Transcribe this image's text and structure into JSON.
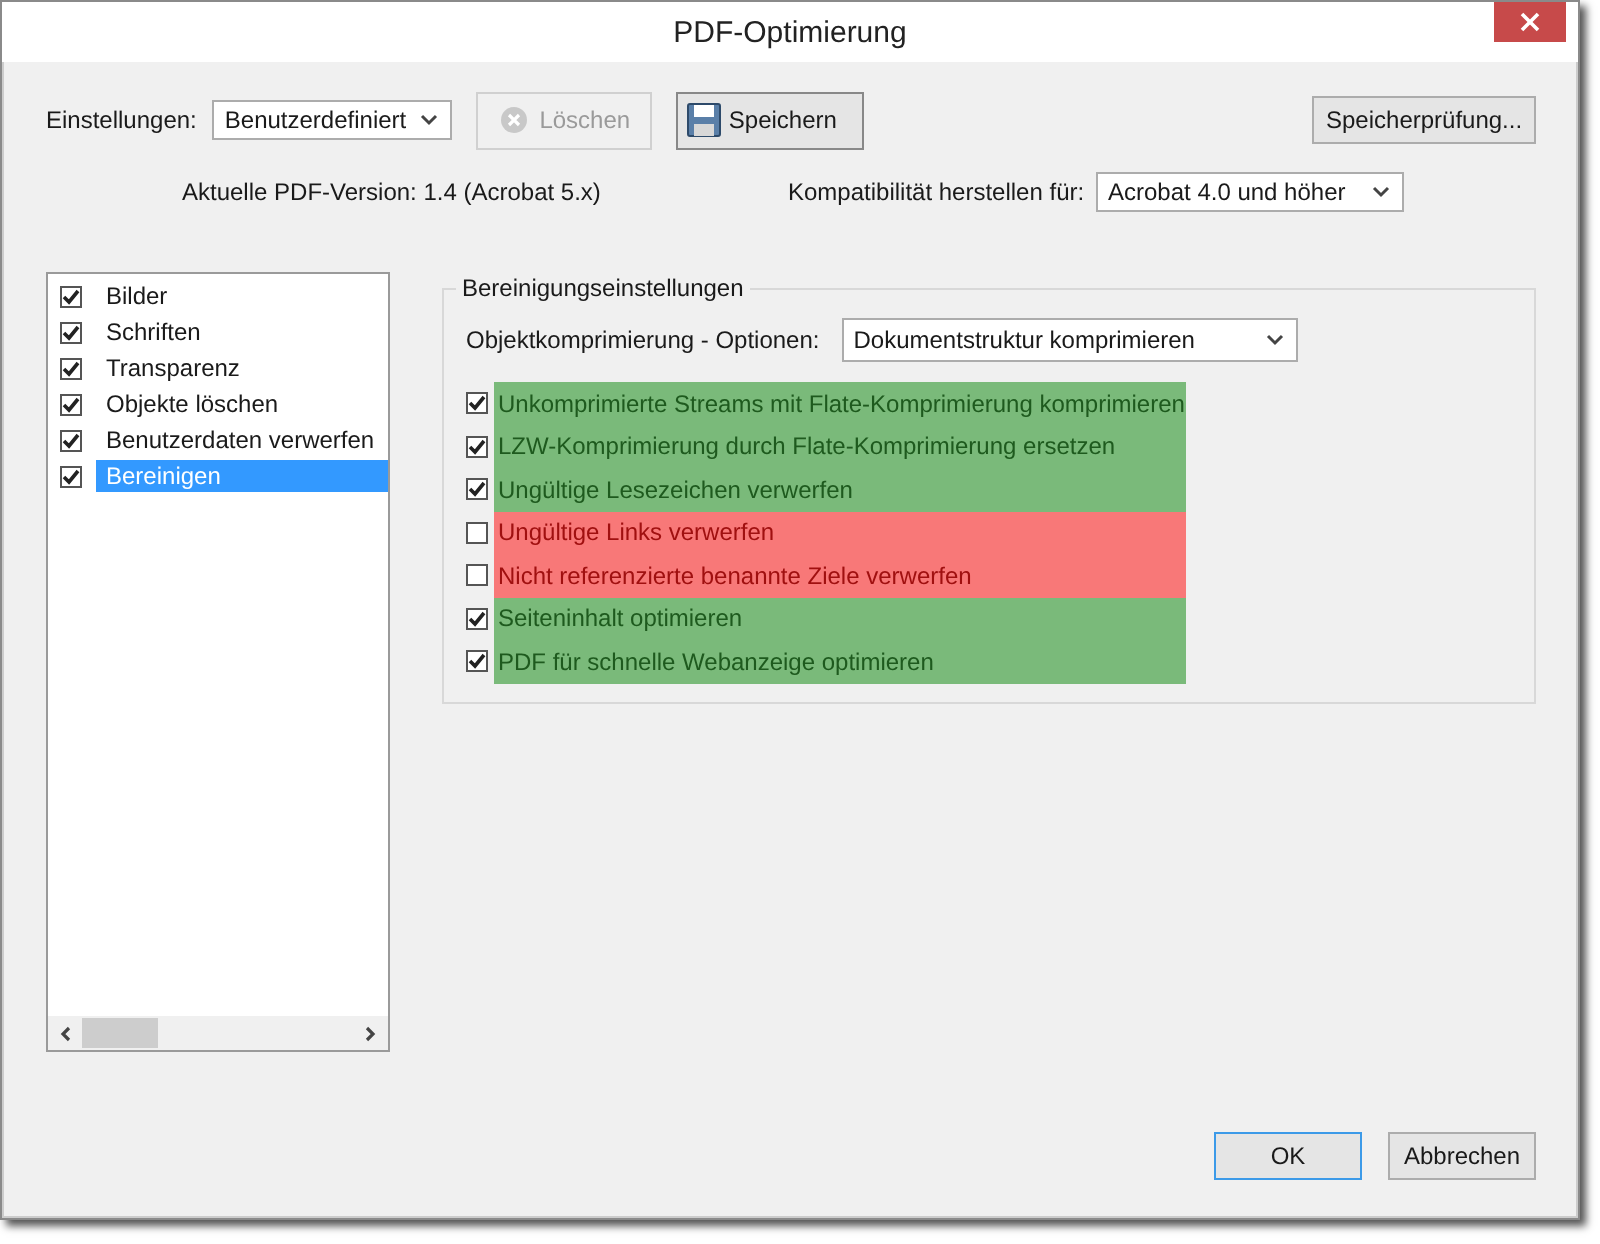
{
  "window": {
    "title": "PDF-Optimierung"
  },
  "settings": {
    "label": "Einstellungen:",
    "value": "Benutzerdefiniert"
  },
  "toolbar": [
    {
      "kind": "delete",
      "label": "Löschen",
      "disabled": true
    },
    {
      "kind": "save",
      "label": "Speichern",
      "disabled": false
    }
  ],
  "audit_button": "Speicherprüfung...",
  "version_text": "Aktuelle PDF-Version: 1.4 (Acrobat 5.x)",
  "compatibility": {
    "label": "Kompatibilität herstellen für:",
    "value": "Acrobat 4.0 und höher"
  },
  "sidebar": {
    "items": [
      {
        "label": "Bilder",
        "checked": true,
        "selected": false
      },
      {
        "label": "Schriften",
        "checked": true,
        "selected": false
      },
      {
        "label": "Transparenz",
        "checked": true,
        "selected": false
      },
      {
        "label": "Objekte löschen",
        "checked": true,
        "selected": false
      },
      {
        "label": "Benutzerdaten verwerfen",
        "checked": true,
        "selected": false
      },
      {
        "label": "Bereinigen",
        "checked": true,
        "selected": true
      }
    ]
  },
  "panel": {
    "title": "Bereinigungseinstellungen",
    "compression": {
      "label": "Objektkomprimierung - Optionen:",
      "value": "Dokumentstruktur komprimieren"
    },
    "options": [
      {
        "label": "Unkomprimierte Streams mit Flate-Komprimierung komprimieren",
        "checked": true,
        "color": "#7aba7a"
      },
      {
        "label": "LZW-Komprimierung durch Flate-Komprimierung ersetzen",
        "checked": true,
        "color": "#7aba7a"
      },
      {
        "label": "Ungültige Lesezeichen verwerfen",
        "checked": true,
        "color": "#7aba7a"
      },
      {
        "label": "Ungültige Links verwerfen",
        "checked": false,
        "color": "#f87878"
      },
      {
        "label": "Nicht referenzierte benannte Ziele verwerfen",
        "checked": false,
        "color": "#f87878"
      },
      {
        "label": "Seiteninhalt optimieren",
        "checked": true,
        "color": "#7aba7a"
      },
      {
        "label": "PDF für schnelle Webanzeige optimieren",
        "checked": true,
        "color": "#7aba7a"
      }
    ]
  },
  "buttons": [
    {
      "label": "OK",
      "default": true
    },
    {
      "label": "Abbrechen",
      "default": false
    }
  ]
}
